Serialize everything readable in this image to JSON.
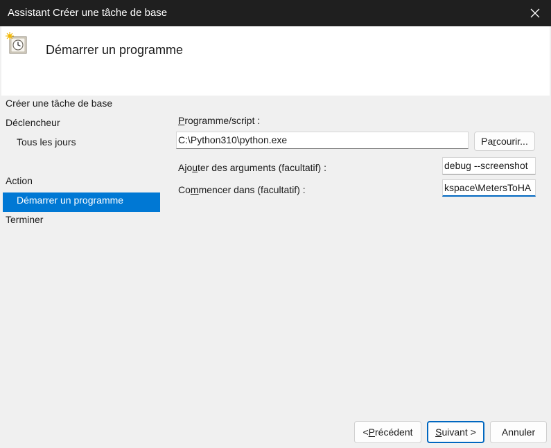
{
  "window": {
    "title": "Assistant Créer une tâche de base"
  },
  "header": {
    "heading": "Démarrer un programme"
  },
  "nav": {
    "items": [
      {
        "label": "Créer une tâche de base"
      },
      {
        "label": "Déclencheur"
      },
      {
        "label": "Tous les jours"
      },
      {
        "label": "Action"
      },
      {
        "label": "Démarrer un programme",
        "selected": true
      },
      {
        "label": "Terminer"
      }
    ]
  },
  "form": {
    "program": {
      "label": "Programme/script :",
      "value": "C:\\Python310\\python.exe"
    },
    "browse_label": "Parcourir...",
    "arguments": {
      "label": "Ajouter des arguments (facultatif) :",
      "value_visible": "debug --screenshot"
    },
    "start_in": {
      "label": "Commencer dans (facultatif) :",
      "value_visible": "kspace\\MetersToHA"
    }
  },
  "footer": {
    "back_label": "< Précédent",
    "next_label": "Suivant >",
    "cancel_label": "Annuler"
  },
  "colors": {
    "titlebar_bg": "#1f1f1f",
    "selection_bg": "#0078d4",
    "focus_accent": "#0067c0",
    "body_bg": "#f0f0f0"
  },
  "icons": {
    "close": "close-icon",
    "task": "scheduled-task-clock-icon"
  }
}
